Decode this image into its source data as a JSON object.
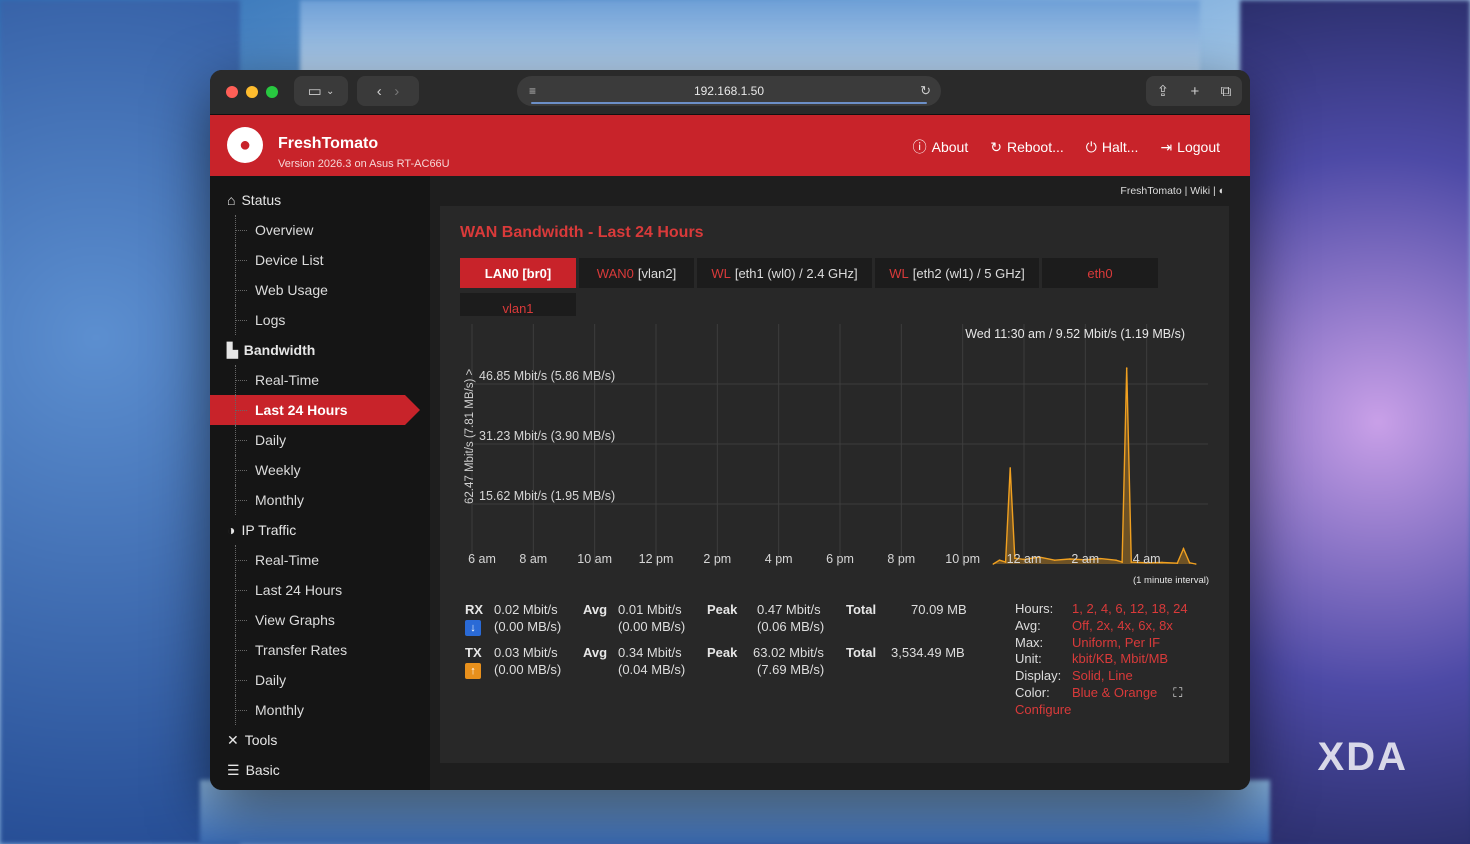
{
  "browser": {
    "url": "192.168.1.50"
  },
  "header": {
    "brand": "FreshTomato",
    "version": "Version 2026.3 on Asus RT-AC66U",
    "nav": [
      "About",
      "Reboot...",
      "Halt...",
      "Logout"
    ]
  },
  "breadcrumb": "FreshTomato | Wiki | ◐",
  "sidebar": {
    "status": "Status",
    "status_items": [
      "Overview",
      "Device List",
      "Web Usage",
      "Logs"
    ],
    "bandwidth": "Bandwidth",
    "bandwidth_items": [
      "Real-Time",
      "Last 24 Hours",
      "Daily",
      "Weekly",
      "Monthly"
    ],
    "iptraffic": "IP Traffic",
    "iptraffic_items": [
      "Real-Time",
      "Last 24 Hours",
      "View Graphs",
      "Transfer Rates",
      "Daily",
      "Monthly"
    ],
    "tools": "Tools",
    "basic": "Basic"
  },
  "panel": {
    "title": "WAN Bandwidth - Last 24 Hours",
    "tabs": [
      {
        "pre": "",
        "label": "LAN0 [br0]"
      },
      {
        "pre": "WAN0",
        "label": "[vlan2]"
      },
      {
        "pre": "WL",
        "label": "[eth1 (wl0) / 2.4 GHz]"
      },
      {
        "pre": "WL",
        "label": "[eth2 (wl1) / 5 GHz]"
      },
      {
        "pre": "",
        "label": "eth0"
      },
      {
        "pre": "",
        "label": "vlan1"
      }
    ]
  },
  "chart_data": {
    "type": "area",
    "title": "",
    "ylabel": "62.47 Mbit/s (7.81 MB/s) >",
    "hover": "Wed 11:30 am / 9.52 Mbit/s (1.19 MB/s)",
    "ytick_labels": [
      "46.85 Mbit/s (5.86 MB/s)",
      "31.23 Mbit/s (3.90 MB/s)",
      "15.62 Mbit/s (1.95 MB/s)"
    ],
    "ytick_values": [
      46.85,
      31.23,
      15.62
    ],
    "ylim": [
      0,
      62.47
    ],
    "xtick_labels": [
      "6 am",
      "8 am",
      "10 am",
      "12 pm",
      "2 pm",
      "4 pm",
      "6 pm",
      "8 pm",
      "10 pm",
      "12 am",
      "2 am",
      "4 am"
    ],
    "xlim_hours": [
      0,
      24
    ],
    "note": "(1 minute interval)",
    "series": [
      {
        "name": "",
        "color": "#f0a020",
        "x": [
          17.0,
          17.2,
          17.4,
          17.55,
          17.7,
          18.0,
          18.5,
          19.0,
          19.5,
          20.0,
          20.5,
          21.0,
          21.2,
          21.35,
          21.5,
          22.0,
          22.5,
          23.0,
          23.2,
          23.4,
          23.6
        ],
        "y": [
          0,
          1,
          0.5,
          25,
          1.5,
          1.2,
          1.8,
          1.0,
          1.3,
          1.1,
          1.4,
          1.0,
          0.5,
          51,
          0.5,
          0.3,
          0.4,
          0.2,
          4,
          0.3,
          0
        ]
      }
    ],
    "grid": true
  },
  "stats": {
    "rx": {
      "label": "RX",
      "cur": "0.02 Mbit/s",
      "cur2": "(0.00 MB/s)",
      "avg": "0.01 Mbit/s",
      "avg2": "(0.00 MB/s)",
      "peak": "0.47 Mbit/s",
      "peak2": "(0.06 MB/s)",
      "total": "70.09 MB"
    },
    "tx": {
      "label": "TX",
      "cur": "0.03 Mbit/s",
      "cur2": "(0.00 MB/s)",
      "avg": "0.34 Mbit/s",
      "avg2": "(0.04 MB/s)",
      "peak": "63.02 Mbit/s",
      "peak2": "(7.69 MB/s)",
      "total": "3,534.49 MB"
    },
    "avg_label": "Avg",
    "peak_label": "Peak",
    "total_label": "Total"
  },
  "options": {
    "hours_label": "Hours:",
    "hours": "1, 2, 4, 6, 12, 18, 24",
    "avg_label": "Avg:",
    "avg": "Off, 2x, 4x, 6x, 8x",
    "max_label": "Max:",
    "max": "Uniform, Per IF",
    "unit_label": "Unit:",
    "unit": "kbit/KB, Mbit/MB",
    "display_label": "Display:",
    "display": "Solid, Line",
    "color_label": "Color:",
    "color": "Blue & Orange",
    "configure": "Configure"
  },
  "watermark": "XDA",
  "colors": {
    "accent": "#c8232a",
    "orange": "#f0a020",
    "blue": "#2a6ad6"
  }
}
